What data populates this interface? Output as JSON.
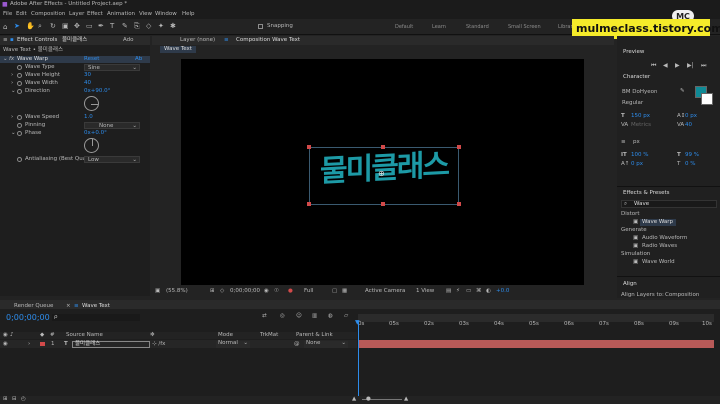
{
  "app": {
    "title": "Adobe After Effects - Untitled Project.aep *",
    "menu": [
      "File",
      "Edit",
      "Composition",
      "Layer",
      "Effect",
      "Animation",
      "View",
      "Window",
      "Help"
    ]
  },
  "toolbar": {
    "snapping_label": "Snapping",
    "workspaces": [
      "Default",
      "Learn",
      "Standard",
      "Small Screen",
      "Librar"
    ]
  },
  "watermark": {
    "logo_text": "MC",
    "site": "mulmeclass.tistory.com"
  },
  "effect_controls": {
    "tab_label": "Effect Controls",
    "tab_layer": "물미클래스",
    "tab_extra": "Ado",
    "header": "Wave Text • 물미클래스",
    "effect_name": "Wave Warp",
    "reset_label": "Reset",
    "about_label": "Ab",
    "props": [
      {
        "name": "Wave Type",
        "value": "Sine"
      },
      {
        "name": "Wave Height",
        "value": "30"
      },
      {
        "name": "Wave Width",
        "value": "40"
      },
      {
        "name": "Direction",
        "value": "0x+90.0°"
      },
      {
        "name": "Wave Speed",
        "value": "1.0"
      },
      {
        "name": "Pinning",
        "value": "None"
      },
      {
        "name": "Phase",
        "value": "0x+0.0°"
      },
      {
        "name": "Antialiasing (Best Qua",
        "value": "Low"
      }
    ]
  },
  "composition": {
    "layer_tab": "Layer  (none)",
    "comp_tab": "Composition  Wave Text",
    "breadcrumb": "Wave Text",
    "canvas_text": "물미클래스",
    "zoom": "(55.8%)",
    "timecode": "0;00;00;00",
    "resolution": "Full",
    "camera": "Active Camera",
    "view": "1 View",
    "exposure": "+0.0"
  },
  "right_panel": {
    "preview_title": "Preview",
    "character_title": "Character",
    "font_name": "BM DoHyeon",
    "font_style": "Regular",
    "font_size": "150 px",
    "kerning": "0 px",
    "tracking": "40",
    "metrics": "Metrics",
    "leading_unit": "px",
    "vscale": "100 %",
    "hscale": "99 %",
    "baseline": "0 px",
    "tsume": "0 %",
    "effects_title": "Effects & Presets",
    "search_value": "Wave",
    "categories": [
      {
        "name": "Distort",
        "items": [
          "Wave Warp"
        ]
      },
      {
        "name": "Generate",
        "items": [
          "Audio Waveform",
          "Radio Waves"
        ]
      },
      {
        "name": "Simulation",
        "items": [
          "Wave World"
        ]
      }
    ],
    "align_title": "Align",
    "align_label": "Align Layers to:",
    "align_value": "Composition",
    "accent_color": "#0f8a96"
  },
  "timeline": {
    "render_queue_tab": "Render Queue",
    "comp_tab": "Wave Text",
    "timecode": "0;00;00;00",
    "search_placeholder": "ρ",
    "col_source": "Source Name",
    "col_mode": "Mode",
    "col_trkmat": "TrkMat",
    "col_parent": "Parent & Link",
    "ruler": [
      "0s",
      "05s",
      "02s",
      "03s",
      "04s",
      "05s",
      "06s",
      "07s",
      "08s",
      "09s",
      "10s"
    ],
    "layer": {
      "number": "1",
      "name": "물미클래스",
      "mode": "Normal",
      "parent": "None"
    },
    "bar_color": "#b85a58"
  }
}
